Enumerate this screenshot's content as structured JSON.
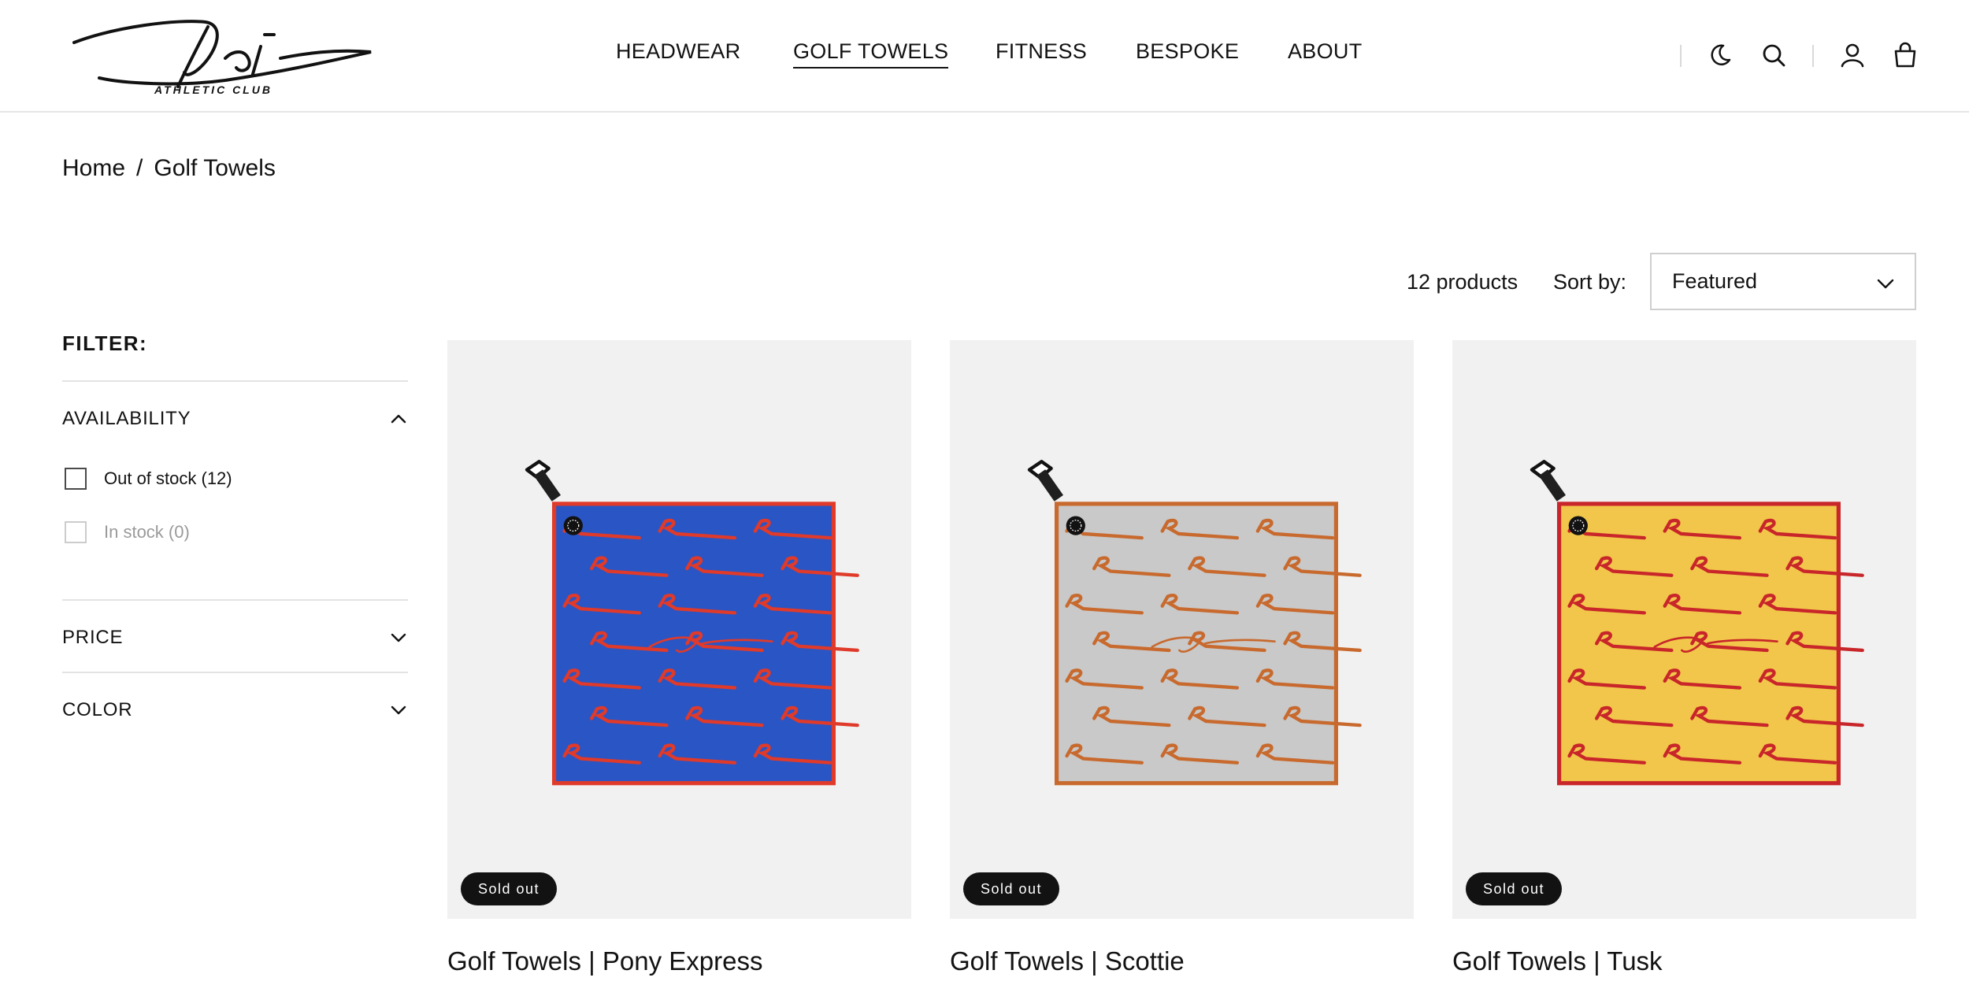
{
  "brand": {
    "name": "Rieti",
    "tagline": "ATHLETIC CLUB"
  },
  "nav": {
    "items": [
      {
        "label": "HEADWEAR"
      },
      {
        "label": "GOLF TOWELS"
      },
      {
        "label": "FITNESS"
      },
      {
        "label": "BESPOKE"
      },
      {
        "label": "ABOUT"
      }
    ],
    "active_index": 1
  },
  "header_icons": [
    "moon-icon",
    "search-icon",
    "account-icon",
    "cart-icon"
  ],
  "breadcrumb": {
    "home": "Home",
    "separator": "/",
    "current": "Golf Towels"
  },
  "toolbar": {
    "product_count": "12 products",
    "sort_label": "Sort by:",
    "sort_value": "Featured"
  },
  "filter": {
    "title": "FILTER:",
    "groups": [
      {
        "label": "AVAILABILITY",
        "expanded": true,
        "options": [
          {
            "label": "Out of stock (12)",
            "enabled": true,
            "checked": false
          },
          {
            "label": "In stock (0)",
            "enabled": false,
            "checked": false
          }
        ]
      },
      {
        "label": "PRICE",
        "expanded": false
      },
      {
        "label": "COLOR",
        "expanded": false
      }
    ]
  },
  "products": [
    {
      "title": "Golf Towels | Pony Express",
      "badge": "Sold out",
      "colors": {
        "field": "#2a55c4",
        "border": "#e03a2a",
        "pattern": "#e03a2a"
      }
    },
    {
      "title": "Golf Towels | Scottie",
      "badge": "Sold out",
      "colors": {
        "field": "#c9c9c9",
        "border": "#c86a2e",
        "pattern": "#c86a2e"
      }
    },
    {
      "title": "Golf Towels | Tusk",
      "badge": "Sold out",
      "colors": {
        "field": "#f2c64a",
        "border": "#c8262a",
        "pattern": "#c8262a"
      }
    }
  ]
}
